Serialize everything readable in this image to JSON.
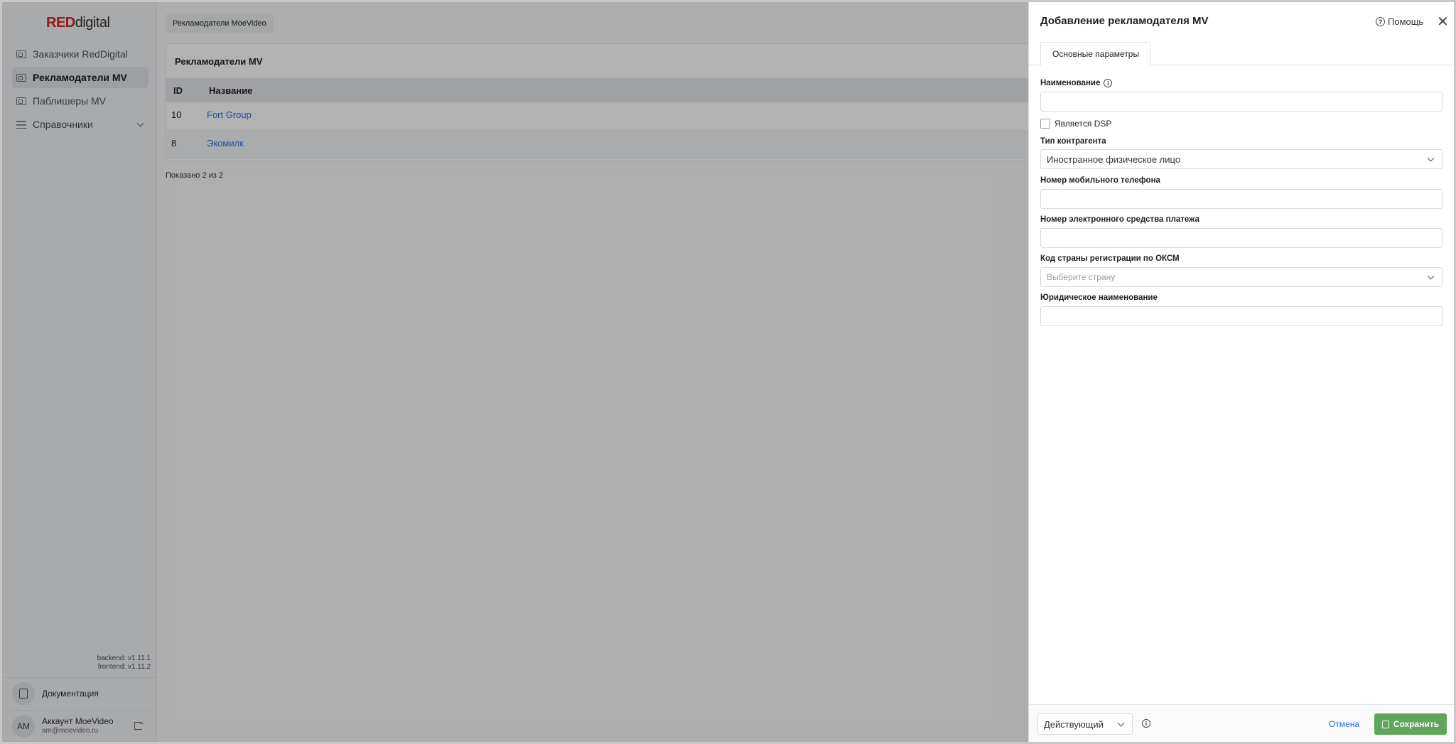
{
  "app": {
    "logo_red": "RED",
    "logo_rest": "digital"
  },
  "sidebar": {
    "items": [
      {
        "label": "Заказчики RedDigital",
        "active": false,
        "icon": "id-card-icon"
      },
      {
        "label": "Рекламодатели MV",
        "active": true,
        "icon": "id-card-icon"
      },
      {
        "label": "Паблишеры MV",
        "active": false,
        "icon": "id-card-icon"
      },
      {
        "label": "Справочники",
        "active": false,
        "icon": "list-icon"
      }
    ],
    "backend_version": "backend: v1.11.1",
    "frontend_version": "frontend: v1.11.2",
    "documentation": "Документация",
    "account": {
      "initials": "AM",
      "name": "Аккаунт MoeVideo",
      "email": "am@moevideo.ru"
    }
  },
  "main": {
    "breadcrumb": "Рекламодатели MoeVideo",
    "card_title": "Рекламодатели MV",
    "columns": [
      "ID",
      "Название"
    ],
    "rows": [
      {
        "id": "10",
        "name": "Fort Group"
      },
      {
        "id": "8",
        "name": "Экомилк"
      }
    ],
    "shown": "Показано 2 из 2"
  },
  "drawer": {
    "title": "Добавление рекламодателя MV",
    "help": "Помощь",
    "tab": "Основные параметры",
    "name_label": "Наименование",
    "name_value": "",
    "dsp_label": "Является DSP",
    "dsp_checked": false,
    "type_label": "Тип контрагента",
    "type_value": "Иностранное физическое лицо",
    "phone_label": "Номер мобильного телефона",
    "phone_value": "",
    "payment_label": "Номер электронного средства платежа",
    "payment_value": "",
    "country_label": "Код страны регистрации по ОКСМ",
    "country_placeholder": "Выберите страну",
    "legal_label": "Юридическое наименование",
    "legal_value": "",
    "status_value": "Действующий",
    "cancel": "Отмена",
    "save": "Сохранить",
    "colors": {
      "save_bg": "#5fa65a",
      "link": "#2a6fdb"
    }
  }
}
